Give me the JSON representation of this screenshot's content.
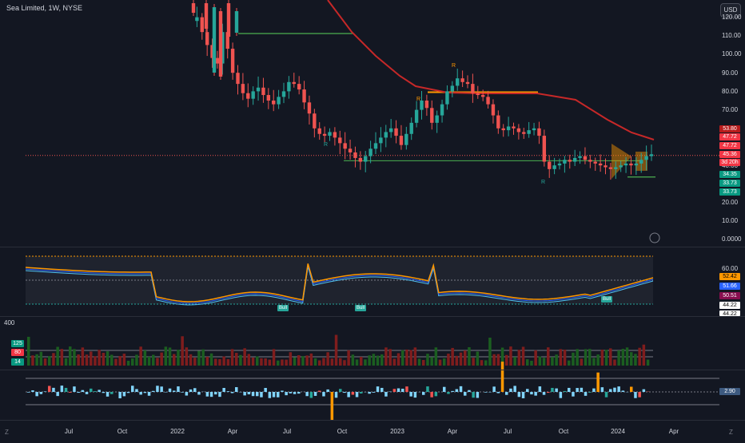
{
  "header": {
    "symbol_title": "Sea Limited, 1W, NYSE",
    "currency": "USD"
  },
  "price_axis": [
    "120.00",
    "110.00",
    "100.00",
    "90.00",
    "80.00",
    "70.00",
    "60.00",
    "50.00",
    "40.00",
    "30.00",
    "20.00",
    "10.00",
    "0.0000"
  ],
  "price_tags": [
    {
      "text": "53.80",
      "color": "#b71c1c"
    },
    {
      "text": "47.72",
      "color": "#f23645"
    },
    {
      "text": "47.72",
      "color": "#f23645"
    },
    {
      "text": "45.36",
      "color": "#f23645"
    },
    {
      "text": "3d 20h",
      "color": "#f23645"
    },
    {
      "text": "34.35",
      "color": "#089981"
    },
    {
      "text": "33.73",
      "color": "#089981"
    },
    {
      "text": "33.73",
      "color": "#089981"
    }
  ],
  "rsi_axis": [
    "60.00"
  ],
  "rsi_tags": [
    {
      "text": "52.42",
      "color": "#ff9800",
      "fg": "#000"
    },
    {
      "text": "51.66",
      "color": "#2962ff",
      "fg": "#fff"
    },
    {
      "text": "50.51",
      "color": "#880e4f",
      "fg": "#fff"
    },
    {
      "text": "44.22",
      "color": "#ffffff",
      "fg": "#000"
    },
    {
      "text": "44.22",
      "color": "#ffffff",
      "fg": "#000"
    }
  ],
  "volume_panel": {
    "top_label": "400",
    "tags": [
      {
        "text": "125",
        "color": "#089981"
      },
      {
        "text": "80",
        "color": "#f23645"
      },
      {
        "text": "14",
        "color": "#089981"
      }
    ]
  },
  "osc_panel": {
    "tag": "2.90"
  },
  "x_axis": [
    "Jul",
    "Oct",
    "2022",
    "Apr",
    "Jul",
    "Oct",
    "2023",
    "Apr",
    "Jul",
    "Oct",
    "2024",
    "Apr"
  ],
  "markers": {
    "r_label": "R",
    "bull_label": "Bull"
  },
  "corner": {
    "left": "Z",
    "right": "Z"
  },
  "colors": {
    "bg": "#131722",
    "up": "#26a69a",
    "down": "#ef5350",
    "ma": "#c62828",
    "orange": "#ff9800",
    "green_line": "#4caf50"
  },
  "chart_data": {
    "type": "candlestick",
    "ylim": [
      0,
      125
    ],
    "series": [
      {
        "name": "price",
        "values": [
          118,
          120,
          112,
          105,
          98,
          95,
          112,
          103,
          90,
          84,
          79,
          76,
          80,
          82,
          78,
          75,
          73,
          77,
          80,
          85,
          84,
          81,
          74,
          68,
          60,
          57,
          56,
          58,
          55,
          52,
          49,
          47,
          44,
          42,
          45,
          49,
          52,
          55,
          58,
          60,
          56,
          51,
          57,
          63,
          70,
          75,
          71,
          63,
          67,
          73,
          80,
          83,
          87,
          85,
          84,
          79,
          78,
          77,
          73,
          67,
          60,
          59,
          61,
          60,
          58,
          57,
          59,
          60,
          56,
          42,
          38,
          40,
          41,
          43,
          42,
          44,
          45,
          43,
          42,
          41,
          40,
          39,
          38,
          39,
          40,
          41,
          40,
          41,
          43,
          45,
          46
        ]
      }
    ]
  }
}
